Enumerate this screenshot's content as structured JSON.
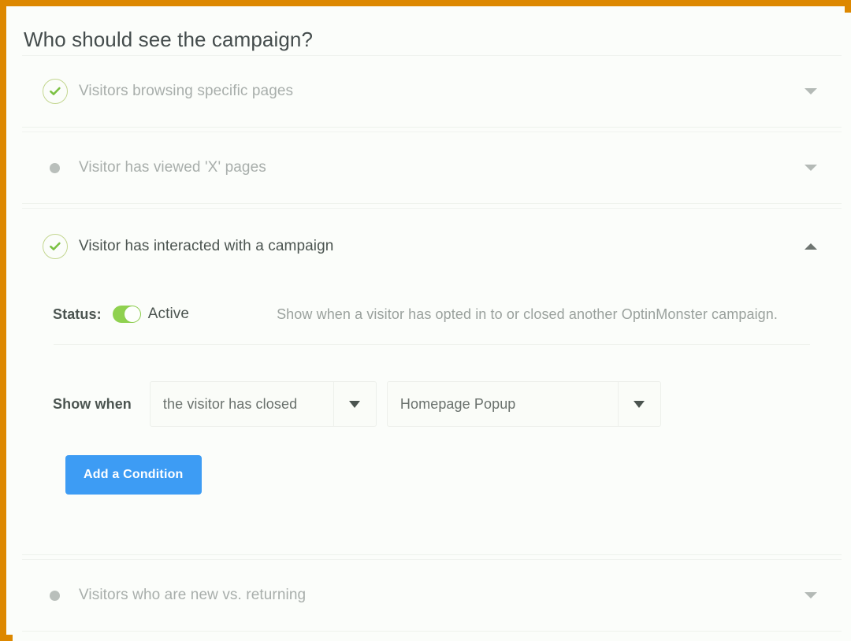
{
  "theme": {
    "frame_color": "#dd8800",
    "page_background": "#fbfdfa",
    "accent_button": "#3d9cf4",
    "toggle_on_color": "#8fd14f",
    "check_circle_border": "#c3d68f",
    "check_mark_color": "#7bc143",
    "inactive_dot": "#b9bfbb",
    "active_title_color": "#4b5450",
    "inactive_title_color": "#a8aeab"
  },
  "page": {
    "title": "Who should see the campaign?"
  },
  "rules": [
    {
      "id": "visitors-browsing-specific-pages",
      "label": "Visitors browsing specific pages",
      "indicator": "check-circle-icon",
      "state": "enabled",
      "expanded": false,
      "chevron": "chevron-down-icon"
    },
    {
      "id": "visitor-has-viewed-x-pages",
      "label": "Visitor has viewed 'X' pages",
      "indicator": "dot-icon",
      "state": "disabled",
      "expanded": false,
      "chevron": "chevron-down-icon"
    },
    {
      "id": "visitor-has-interacted-with-a-campaign",
      "label": "Visitor has interacted with a campaign",
      "indicator": "check-circle-icon",
      "state": "enabled",
      "expanded": true,
      "chevron": "chevron-up-icon"
    },
    {
      "id": "visitors-who-are-new-vs-returning",
      "label": "Visitors who are new vs. returning",
      "indicator": "dot-icon",
      "state": "disabled",
      "expanded": false,
      "chevron": "chevron-down-icon"
    }
  ],
  "expanded_rule": {
    "status": {
      "label": "Status:",
      "toggle_state": "on",
      "toggle_value_text": "Active"
    },
    "description": "Show when a visitor has opted in to or closed another OptinMonster campaign.",
    "show_when": {
      "label": "Show when",
      "event_select": {
        "value": "the visitor has closed",
        "arrow_icon": "caret-down-icon"
      },
      "target_select": {
        "value": "Homepage Popup",
        "arrow_icon": "caret-down-icon"
      }
    },
    "add_condition_button": "Add a Condition"
  },
  "footnote": ""
}
